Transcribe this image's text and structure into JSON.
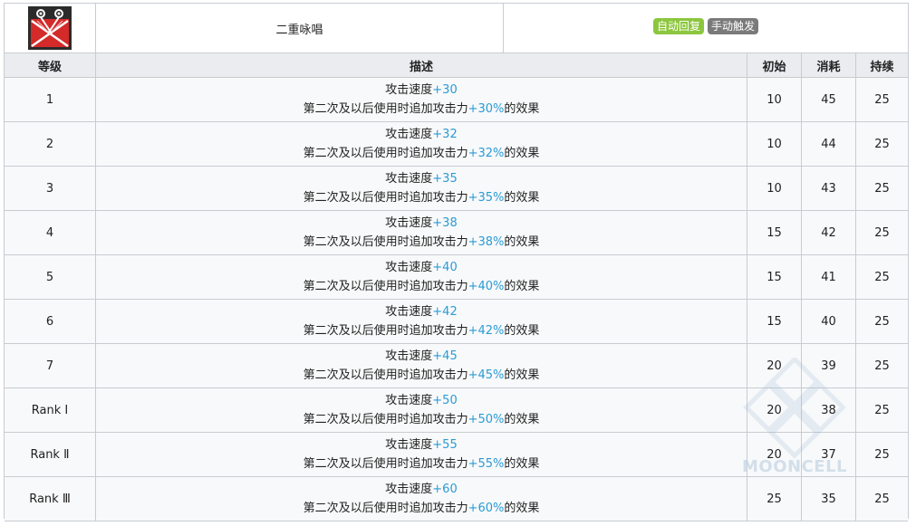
{
  "header": {
    "skill_icon": "crossed-wands-icon",
    "skill_name": "二重咏唱",
    "tags": [
      {
        "label": "自动回复",
        "color": "#8cc63e"
      },
      {
        "label": "手动触发",
        "color": "#7a7a7a"
      }
    ]
  },
  "columns": {
    "level": "等级",
    "description": "描述",
    "initial": "初始",
    "cost": "消耗",
    "duration": "持续"
  },
  "desc_template": {
    "line1_prefix": "攻击速度",
    "line2_prefix": "第二次及以后使用时追加攻击力",
    "line2_suffix": "的效果"
  },
  "accent_color": "#2a9bd6",
  "rows": [
    {
      "level": "1",
      "aspd": "+30",
      "atk": "+30%",
      "initial": "10",
      "cost": "45",
      "duration": "25"
    },
    {
      "level": "2",
      "aspd": "+32",
      "atk": "+32%",
      "initial": "10",
      "cost": "44",
      "duration": "25"
    },
    {
      "level": "3",
      "aspd": "+35",
      "atk": "+35%",
      "initial": "10",
      "cost": "43",
      "duration": "25"
    },
    {
      "level": "4",
      "aspd": "+38",
      "atk": "+38%",
      "initial": "15",
      "cost": "42",
      "duration": "25"
    },
    {
      "level": "5",
      "aspd": "+40",
      "atk": "+40%",
      "initial": "15",
      "cost": "41",
      "duration": "25"
    },
    {
      "level": "6",
      "aspd": "+42",
      "atk": "+42%",
      "initial": "15",
      "cost": "40",
      "duration": "25"
    },
    {
      "level": "7",
      "aspd": "+45",
      "atk": "+45%",
      "initial": "20",
      "cost": "39",
      "duration": "25"
    },
    {
      "level": "Rank Ⅰ",
      "aspd": "+50",
      "atk": "+50%",
      "initial": "20",
      "cost": "38",
      "duration": "25"
    },
    {
      "level": "Rank Ⅱ",
      "aspd": "+55",
      "atk": "+55%",
      "initial": "20",
      "cost": "37",
      "duration": "25"
    },
    {
      "level": "Rank Ⅲ",
      "aspd": "+60",
      "atk": "+60%",
      "initial": "25",
      "cost": "35",
      "duration": "25"
    }
  ],
  "watermark": "MOONCELL"
}
